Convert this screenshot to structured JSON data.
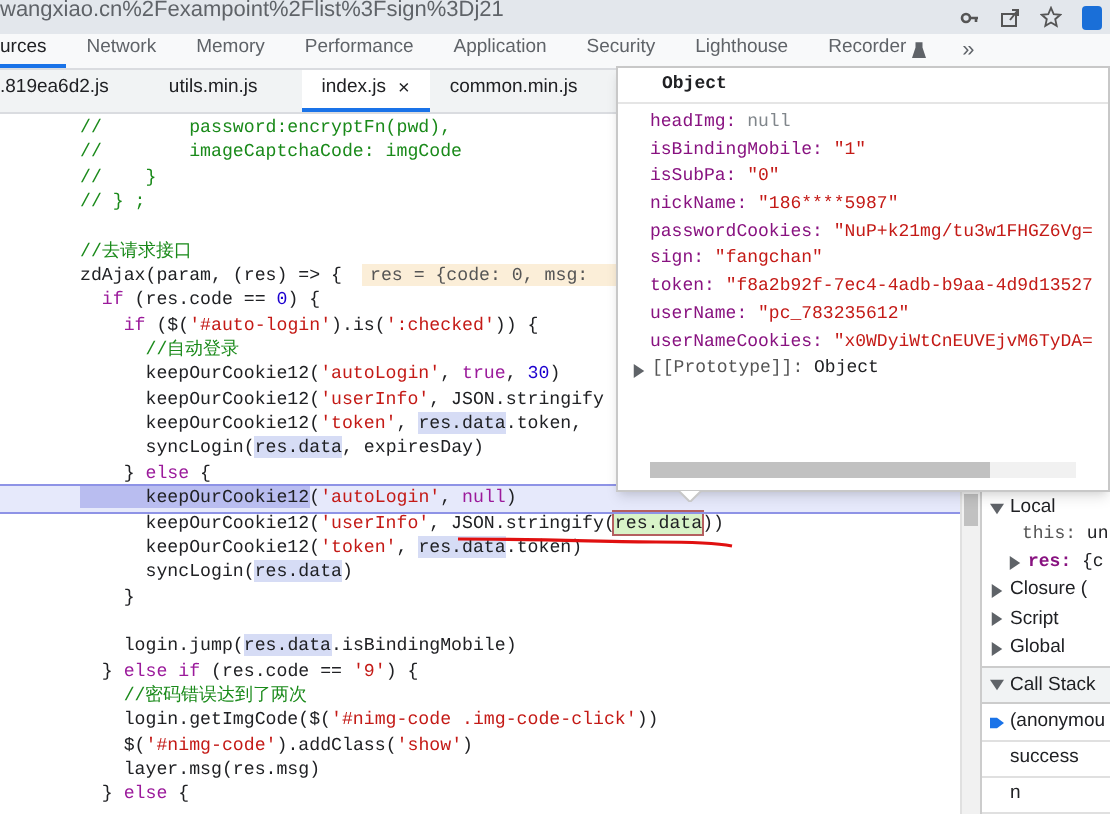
{
  "url_bar": {
    "url": "wangxiao.cn%2Fexampoint%2Flist%3Fsign%3Dj21"
  },
  "devtools_tabs": [
    {
      "label": "urces",
      "selected": true
    },
    {
      "label": "Network",
      "selected": false
    },
    {
      "label": "Memory",
      "selected": false
    },
    {
      "label": "Performance",
      "selected": false
    },
    {
      "label": "Application",
      "selected": false
    },
    {
      "label": "Security",
      "selected": false
    },
    {
      "label": "Lighthouse",
      "selected": false
    },
    {
      "label": "Recorder",
      "selected": false,
      "experimental": true
    }
  ],
  "more_tabs": "»",
  "file_tabs": [
    {
      "label": ".819ea6d2.js",
      "selected": false
    },
    {
      "label": "utils.min.js",
      "selected": false
    },
    {
      "label": "index.js",
      "selected": true,
      "close": "×"
    },
    {
      "label": "common.min.js",
      "selected": false
    }
  ],
  "code_lines": [
    {
      "highlighted": false,
      "segments": [
        {
          "kind": "comment",
          "text": "//        password:encryptFn(pwd),"
        }
      ]
    },
    {
      "highlighted": false,
      "segments": [
        {
          "kind": "comment",
          "text": "//        imageCaptchaCode: imgCode"
        }
      ]
    },
    {
      "highlighted": false,
      "segments": [
        {
          "kind": "comment",
          "text": "//    }"
        }
      ]
    },
    {
      "highlighted": false,
      "segments": [
        {
          "kind": "comment",
          "text": "// } ;"
        }
      ]
    },
    {
      "highlighted": false
    },
    {
      "highlighted": false,
      "segments": [
        {
          "kind": "comment",
          "text": "//去请求接口"
        }
      ]
    },
    {
      "highlighted": false,
      "segments": [
        {
          "kind": "plain",
          "text": "zdAjax(param, (res) => {"
        },
        {
          "kind": "inline-value",
          "text": "res = {code: 0, msg:"
        }
      ]
    },
    {
      "highlighted": false,
      "segments": [
        {
          "kind": "keyword",
          "text": "  if"
        },
        {
          "kind": "plain",
          "text": " (res.code == "
        },
        {
          "kind": "number",
          "text": "0"
        },
        {
          "kind": "plain",
          "text": ") {"
        }
      ]
    },
    {
      "highlighted": false,
      "segments": [
        {
          "kind": "keyword",
          "text": "    if"
        },
        {
          "kind": "plain",
          "text": " ($("
        },
        {
          "kind": "string",
          "text": "'#auto-login'"
        },
        {
          "kind": "plain",
          "text": ").is("
        },
        {
          "kind": "string",
          "text": "':checked'"
        },
        {
          "kind": "plain",
          "text": ")) {"
        }
      ]
    },
    {
      "highlighted": false,
      "segments": [
        {
          "kind": "comment",
          "text": "      //自动登录"
        }
      ]
    },
    {
      "highlighted": false,
      "segments": [
        {
          "kind": "plain",
          "text": "      keepOurCookie12("
        },
        {
          "kind": "string",
          "text": "'autoLogin'"
        },
        {
          "kind": "plain",
          "text": ", "
        },
        {
          "kind": "keyword",
          "text": "true"
        },
        {
          "kind": "plain",
          "text": ", "
        },
        {
          "kind": "number",
          "text": "30"
        },
        {
          "kind": "plain",
          "text": ")"
        }
      ]
    },
    {
      "highlighted": false,
      "segments": [
        {
          "kind": "plain",
          "text": "      keepOurCookie12("
        },
        {
          "kind": "string",
          "text": "'userInfo'"
        },
        {
          "kind": "plain",
          "text": ", JSON.stringify"
        }
      ]
    },
    {
      "highlighted": false,
      "segments": [
        {
          "kind": "plain",
          "text": "      keepOurCookie12("
        },
        {
          "kind": "string",
          "text": "'token'"
        },
        {
          "kind": "plain",
          "text": ", "
        },
        {
          "kind": "match",
          "text": "res.data"
        },
        {
          "kind": "plain",
          "text": ".token,"
        }
      ]
    },
    {
      "highlighted": false,
      "segments": [
        {
          "kind": "plain",
          "text": "      syncLogin("
        },
        {
          "kind": "match",
          "text": "res.data"
        },
        {
          "kind": "plain",
          "text": ", expiresDay)"
        }
      ]
    },
    {
      "highlighted": false,
      "segments": [
        {
          "kind": "plain",
          "text": "    } "
        },
        {
          "kind": "keyword",
          "text": "else"
        },
        {
          "kind": "plain",
          "text": " {"
        }
      ]
    },
    {
      "highlighted": true,
      "segments": [
        {
          "kind": "paused",
          "text": "      keepOurCookie12"
        },
        {
          "kind": "plain",
          "text": "("
        },
        {
          "kind": "string",
          "text": "'autoLogin'"
        },
        {
          "kind": "plain",
          "text": ", "
        },
        {
          "kind": "keyword",
          "text": "null"
        },
        {
          "kind": "plain",
          "text": ")"
        }
      ]
    },
    {
      "highlighted": false,
      "segments": [
        {
          "kind": "plain",
          "text": "      keepOurCookie12("
        },
        {
          "kind": "string",
          "text": "'userInfo'"
        },
        {
          "kind": "plain",
          "text": ", JSON.stringify("
        },
        {
          "kind": "hover",
          "text": "res.data"
        },
        {
          "kind": "plain",
          "text": "))"
        }
      ]
    },
    {
      "highlighted": false,
      "segments": [
        {
          "kind": "plain",
          "text": "      keepOurCookie12("
        },
        {
          "kind": "string",
          "text": "'token'"
        },
        {
          "kind": "plain",
          "text": ", "
        },
        {
          "kind": "match",
          "text": "res.data"
        },
        {
          "kind": "plain",
          "text": ".token)"
        }
      ]
    },
    {
      "highlighted": false,
      "segments": [
        {
          "kind": "plain",
          "text": "      syncLogin("
        },
        {
          "kind": "match",
          "text": "res.data"
        },
        {
          "kind": "plain",
          "text": ")"
        }
      ]
    },
    {
      "highlighted": false,
      "segments": [
        {
          "kind": "plain",
          "text": "    }"
        }
      ]
    },
    {
      "highlighted": false
    },
    {
      "highlighted": false,
      "segments": [
        {
          "kind": "plain",
          "text": "    login.jump("
        },
        {
          "kind": "match",
          "text": "res.data"
        },
        {
          "kind": "plain",
          "text": ".isBindingMobile)"
        }
      ]
    },
    {
      "highlighted": false,
      "segments": [
        {
          "kind": "plain",
          "text": "  } "
        },
        {
          "kind": "keyword",
          "text": "else if"
        },
        {
          "kind": "plain",
          "text": " (res.code == "
        },
        {
          "kind": "string",
          "text": "'9'"
        },
        {
          "kind": "plain",
          "text": ") {"
        }
      ]
    },
    {
      "highlighted": false,
      "segments": [
        {
          "kind": "comment",
          "text": "    //密码错误达到了两次"
        }
      ]
    },
    {
      "highlighted": false,
      "segments": [
        {
          "kind": "plain",
          "text": "    login.getImgCode($("
        },
        {
          "kind": "string",
          "text": "'#nimg-code .img-code-click'"
        },
        {
          "kind": "plain",
          "text": "))"
        }
      ]
    },
    {
      "highlighted": false,
      "segments": [
        {
          "kind": "plain",
          "text": "    $("
        },
        {
          "kind": "string",
          "text": "'#nimg-code'"
        },
        {
          "kind": "plain",
          "text": ").addClass("
        },
        {
          "kind": "string",
          "text": "'show'"
        },
        {
          "kind": "plain",
          "text": ")"
        }
      ]
    },
    {
      "highlighted": false,
      "segments": [
        {
          "kind": "plain",
          "text": "    layer.msg(res.msg)"
        }
      ]
    },
    {
      "highlighted": false,
      "segments": [
        {
          "kind": "plain",
          "text": "  } "
        },
        {
          "kind": "keyword",
          "text": "else"
        },
        {
          "kind": "plain",
          "text": " {"
        }
      ]
    }
  ],
  "popup": {
    "title": "Object",
    "properties": [
      {
        "key": "headImg:",
        "value": "null",
        "kind": "null"
      },
      {
        "key": "isBindingMobile:",
        "value": "\"1\"",
        "kind": "string"
      },
      {
        "key": "isSubPa:",
        "value": "\"0\"",
        "kind": "string"
      },
      {
        "key": "nickName:",
        "value": "\"186****5987\"",
        "kind": "string"
      },
      {
        "key": "passwordCookies:",
        "value": "\"NuP+k21mg/tu3w1FHGZ6Vg=",
        "kind": "string"
      },
      {
        "key": "sign:",
        "value": "\"fangchan\"",
        "kind": "string"
      },
      {
        "key": "token:",
        "value": "\"f8a2b92f-7ec4-4adb-b9aa-4d9d13527",
        "kind": "string"
      },
      {
        "key": "userName:",
        "value": "\"pc_783235612\"",
        "kind": "string"
      },
      {
        "key": "userNameCookies:",
        "value": "\"x0WDyiWtCnEUVEjvM6TyDA=",
        "kind": "string"
      }
    ],
    "prototype": {
      "key": "[[Prototype]]:",
      "value": "Object",
      "expanded": false
    }
  },
  "scope": [
    {
      "kind": "section",
      "label": "Local",
      "expanded": true
    },
    {
      "kind": "entry",
      "key": "this:",
      "value": "un",
      "expandable": false
    },
    {
      "kind": "entry",
      "key": "res:",
      "value": "{c",
      "expandable": true
    },
    {
      "kind": "section",
      "label": "Closure (",
      "expanded": false
    },
    {
      "kind": "section",
      "label": "Script",
      "expanded": false
    },
    {
      "kind": "section",
      "label": "Global",
      "expanded": false
    }
  ],
  "call_stack": {
    "title": "Call Stack",
    "expanded": true,
    "frames": [
      {
        "label": "(anonymou",
        "selected": true
      },
      {
        "label": "success",
        "selected": false
      },
      {
        "label": "n",
        "selected": false
      }
    ]
  }
}
